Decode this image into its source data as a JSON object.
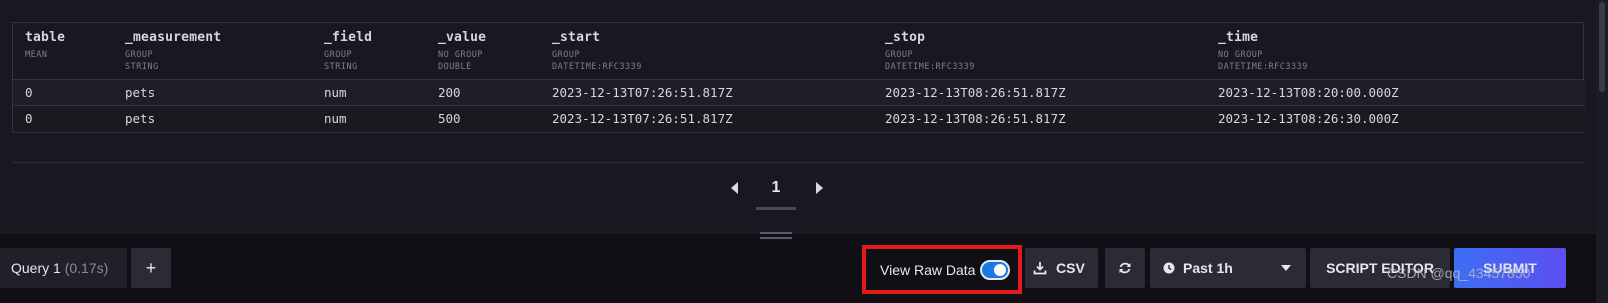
{
  "table": {
    "columns": [
      {
        "name": "table",
        "meta": [
          "MEAN"
        ]
      },
      {
        "name": "_measurement",
        "meta": [
          "GROUP",
          "STRING"
        ]
      },
      {
        "name": "_field",
        "meta": [
          "GROUP",
          "STRING"
        ]
      },
      {
        "name": "_value",
        "meta": [
          "NO GROUP",
          "DOUBLE"
        ]
      },
      {
        "name": "_start",
        "meta": [
          "GROUP",
          "DATETIME:RFC3339"
        ]
      },
      {
        "name": "_stop",
        "meta": [
          "GROUP",
          "DATETIME:RFC3339"
        ]
      },
      {
        "name": "_time",
        "meta": [
          "NO GROUP",
          "DATETIME:RFC3339"
        ]
      }
    ],
    "rows": [
      [
        "0",
        "pets",
        "num",
        "200",
        "2023-12-13T07:26:51.817Z",
        "2023-12-13T08:26:51.817Z",
        "2023-12-13T08:20:00.000Z"
      ],
      [
        "0",
        "pets",
        "num",
        "500",
        "2023-12-13T07:26:51.817Z",
        "2023-12-13T08:26:51.817Z",
        "2023-12-13T08:26:30.000Z"
      ]
    ]
  },
  "pagination": {
    "current_page": "1",
    "prev_icon": "caret-left-icon",
    "next_icon": "caret-right-icon"
  },
  "query": {
    "tab_label": "Query 1",
    "tab_time": "(0.17s)",
    "add_label": "+"
  },
  "toolbar": {
    "view_raw_label": "View Raw Data",
    "view_raw_on": true,
    "csv_label": "CSV",
    "time_range_label": "Past 1h",
    "script_editor_label": "SCRIPT EDITOR",
    "submit_label": "SUBMIT",
    "highlight_color": "#e11a1a",
    "toggle_color": "#1a78e6"
  },
  "watermark": {
    "text": "CSDN @qq_43457850"
  }
}
